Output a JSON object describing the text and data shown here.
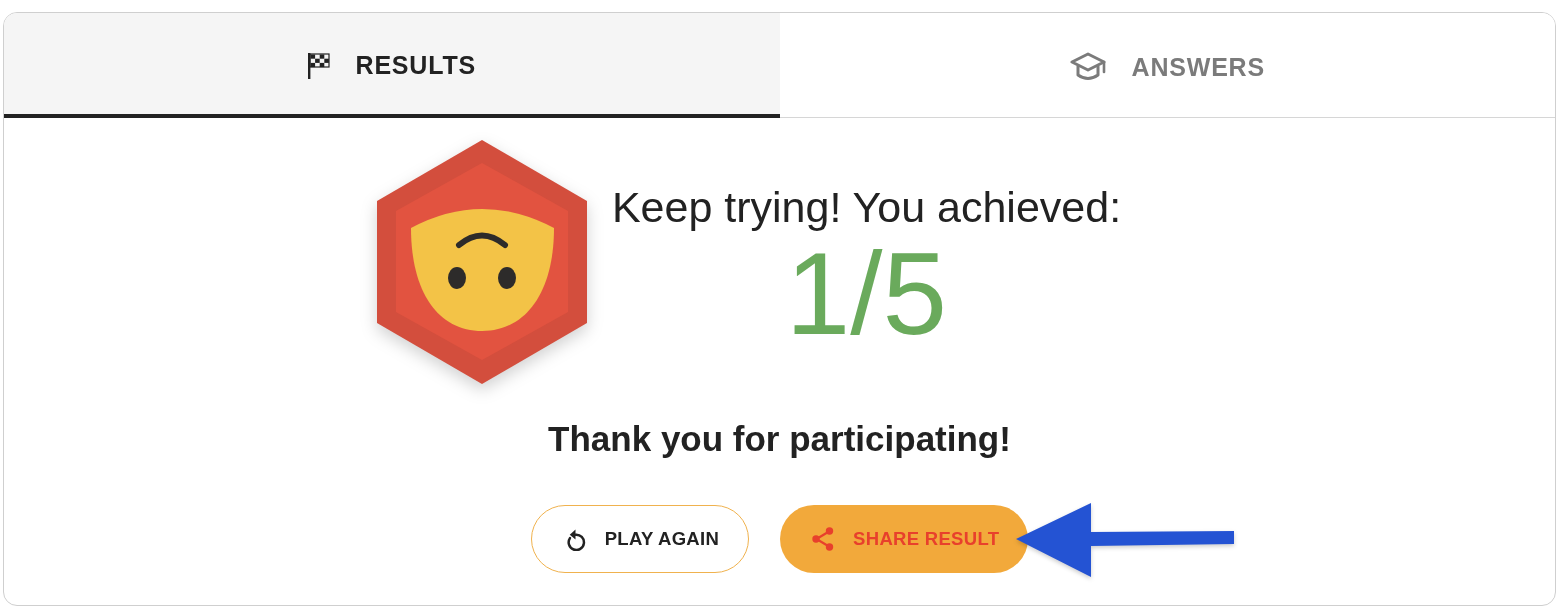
{
  "tabs": [
    {
      "label": "RESULTS",
      "selected": true
    },
    {
      "label": "ANSWERS",
      "selected": false
    }
  ],
  "result": {
    "message": "Keep trying! You achieved:",
    "score": "1/5"
  },
  "thanks": "Thank you for participating!",
  "buttons": [
    {
      "kind": "replay",
      "label": "PLAY AGAIN"
    },
    {
      "kind": "share",
      "label": "SHARE RESULT"
    }
  ]
}
